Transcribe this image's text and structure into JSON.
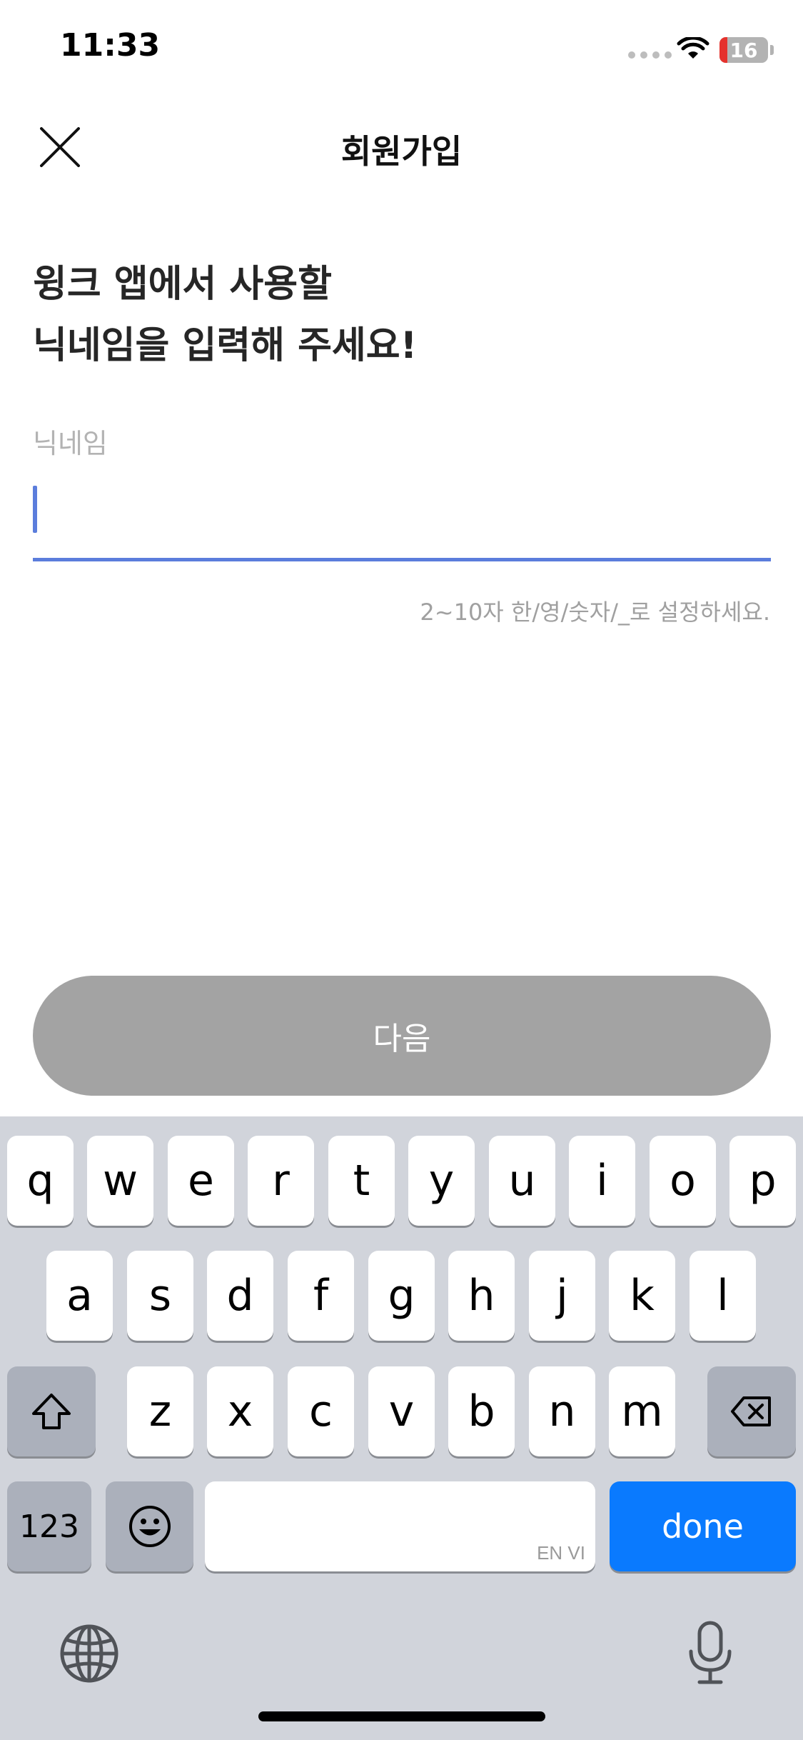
{
  "status_bar": {
    "time": "11:33",
    "battery_level": "16",
    "battery_fraction": 0.16,
    "battery_color": "#e5322d",
    "icons": [
      "signal-dots-icon",
      "wifi-icon",
      "battery-icon"
    ]
  },
  "header": {
    "title": "회원가입",
    "close_icon": "close-icon"
  },
  "content": {
    "headline_line1": "윙크 앱에서 사용할",
    "headline_line2": "닉네임을 입력해 주세요!",
    "field_label": "닉네임",
    "input_value": "",
    "helper_text": "2~10자 한/영/숫자/_로 설정하세요.",
    "accent_color": "#5b7ddc"
  },
  "next_button": {
    "label": "다음",
    "enabled": false,
    "color": "#a3a3a3"
  },
  "keyboard": {
    "row1": [
      "q",
      "w",
      "e",
      "r",
      "t",
      "y",
      "u",
      "i",
      "o",
      "p"
    ],
    "row2": [
      "a",
      "s",
      "d",
      "f",
      "g",
      "h",
      "j",
      "k",
      "l"
    ],
    "row3": [
      "z",
      "x",
      "c",
      "v",
      "b",
      "n",
      "m"
    ],
    "numbers_label": "123",
    "space_hint": "EN VI",
    "done_label": "done",
    "done_color": "#0a7afe",
    "icons": [
      "shift-icon",
      "backspace-icon",
      "emoji-icon",
      "globe-icon",
      "microphone-icon"
    ]
  }
}
